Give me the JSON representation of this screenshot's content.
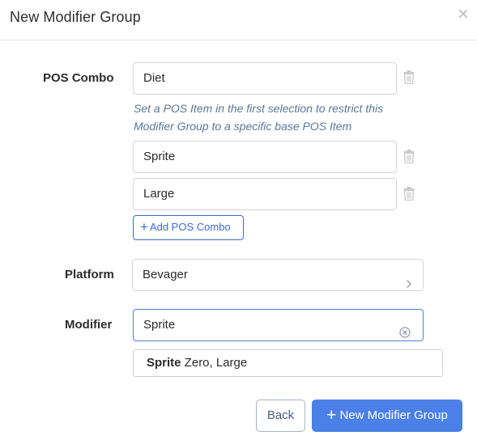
{
  "modal": {
    "title": "New Modifier Group",
    "close_icon": "close-icon"
  },
  "pos_combo": {
    "label": "POS Combo",
    "first_value": "Diet",
    "help_text": "Set a POS Item in the first selection to restrict this Modifier Group to a specific base POS Item",
    "items": [
      "Sprite",
      "Large"
    ],
    "add_label": "Add POS Combo",
    "delete_icon": "trash-icon"
  },
  "platform": {
    "label": "Platform",
    "value": "Bevager",
    "icon": "chevron-right-icon"
  },
  "modifier": {
    "label": "Modifier",
    "value": "Sprite",
    "clear_icon": "circle-x-icon",
    "suggestion_match": "Sprite",
    "suggestion_rest": " Zero, Large"
  },
  "footer": {
    "back_label": "Back",
    "submit_label": "New Modifier Group"
  },
  "colors": {
    "accent": "#4a80e8",
    "help_text": "#5b7796",
    "border": "#d5d5d5"
  }
}
